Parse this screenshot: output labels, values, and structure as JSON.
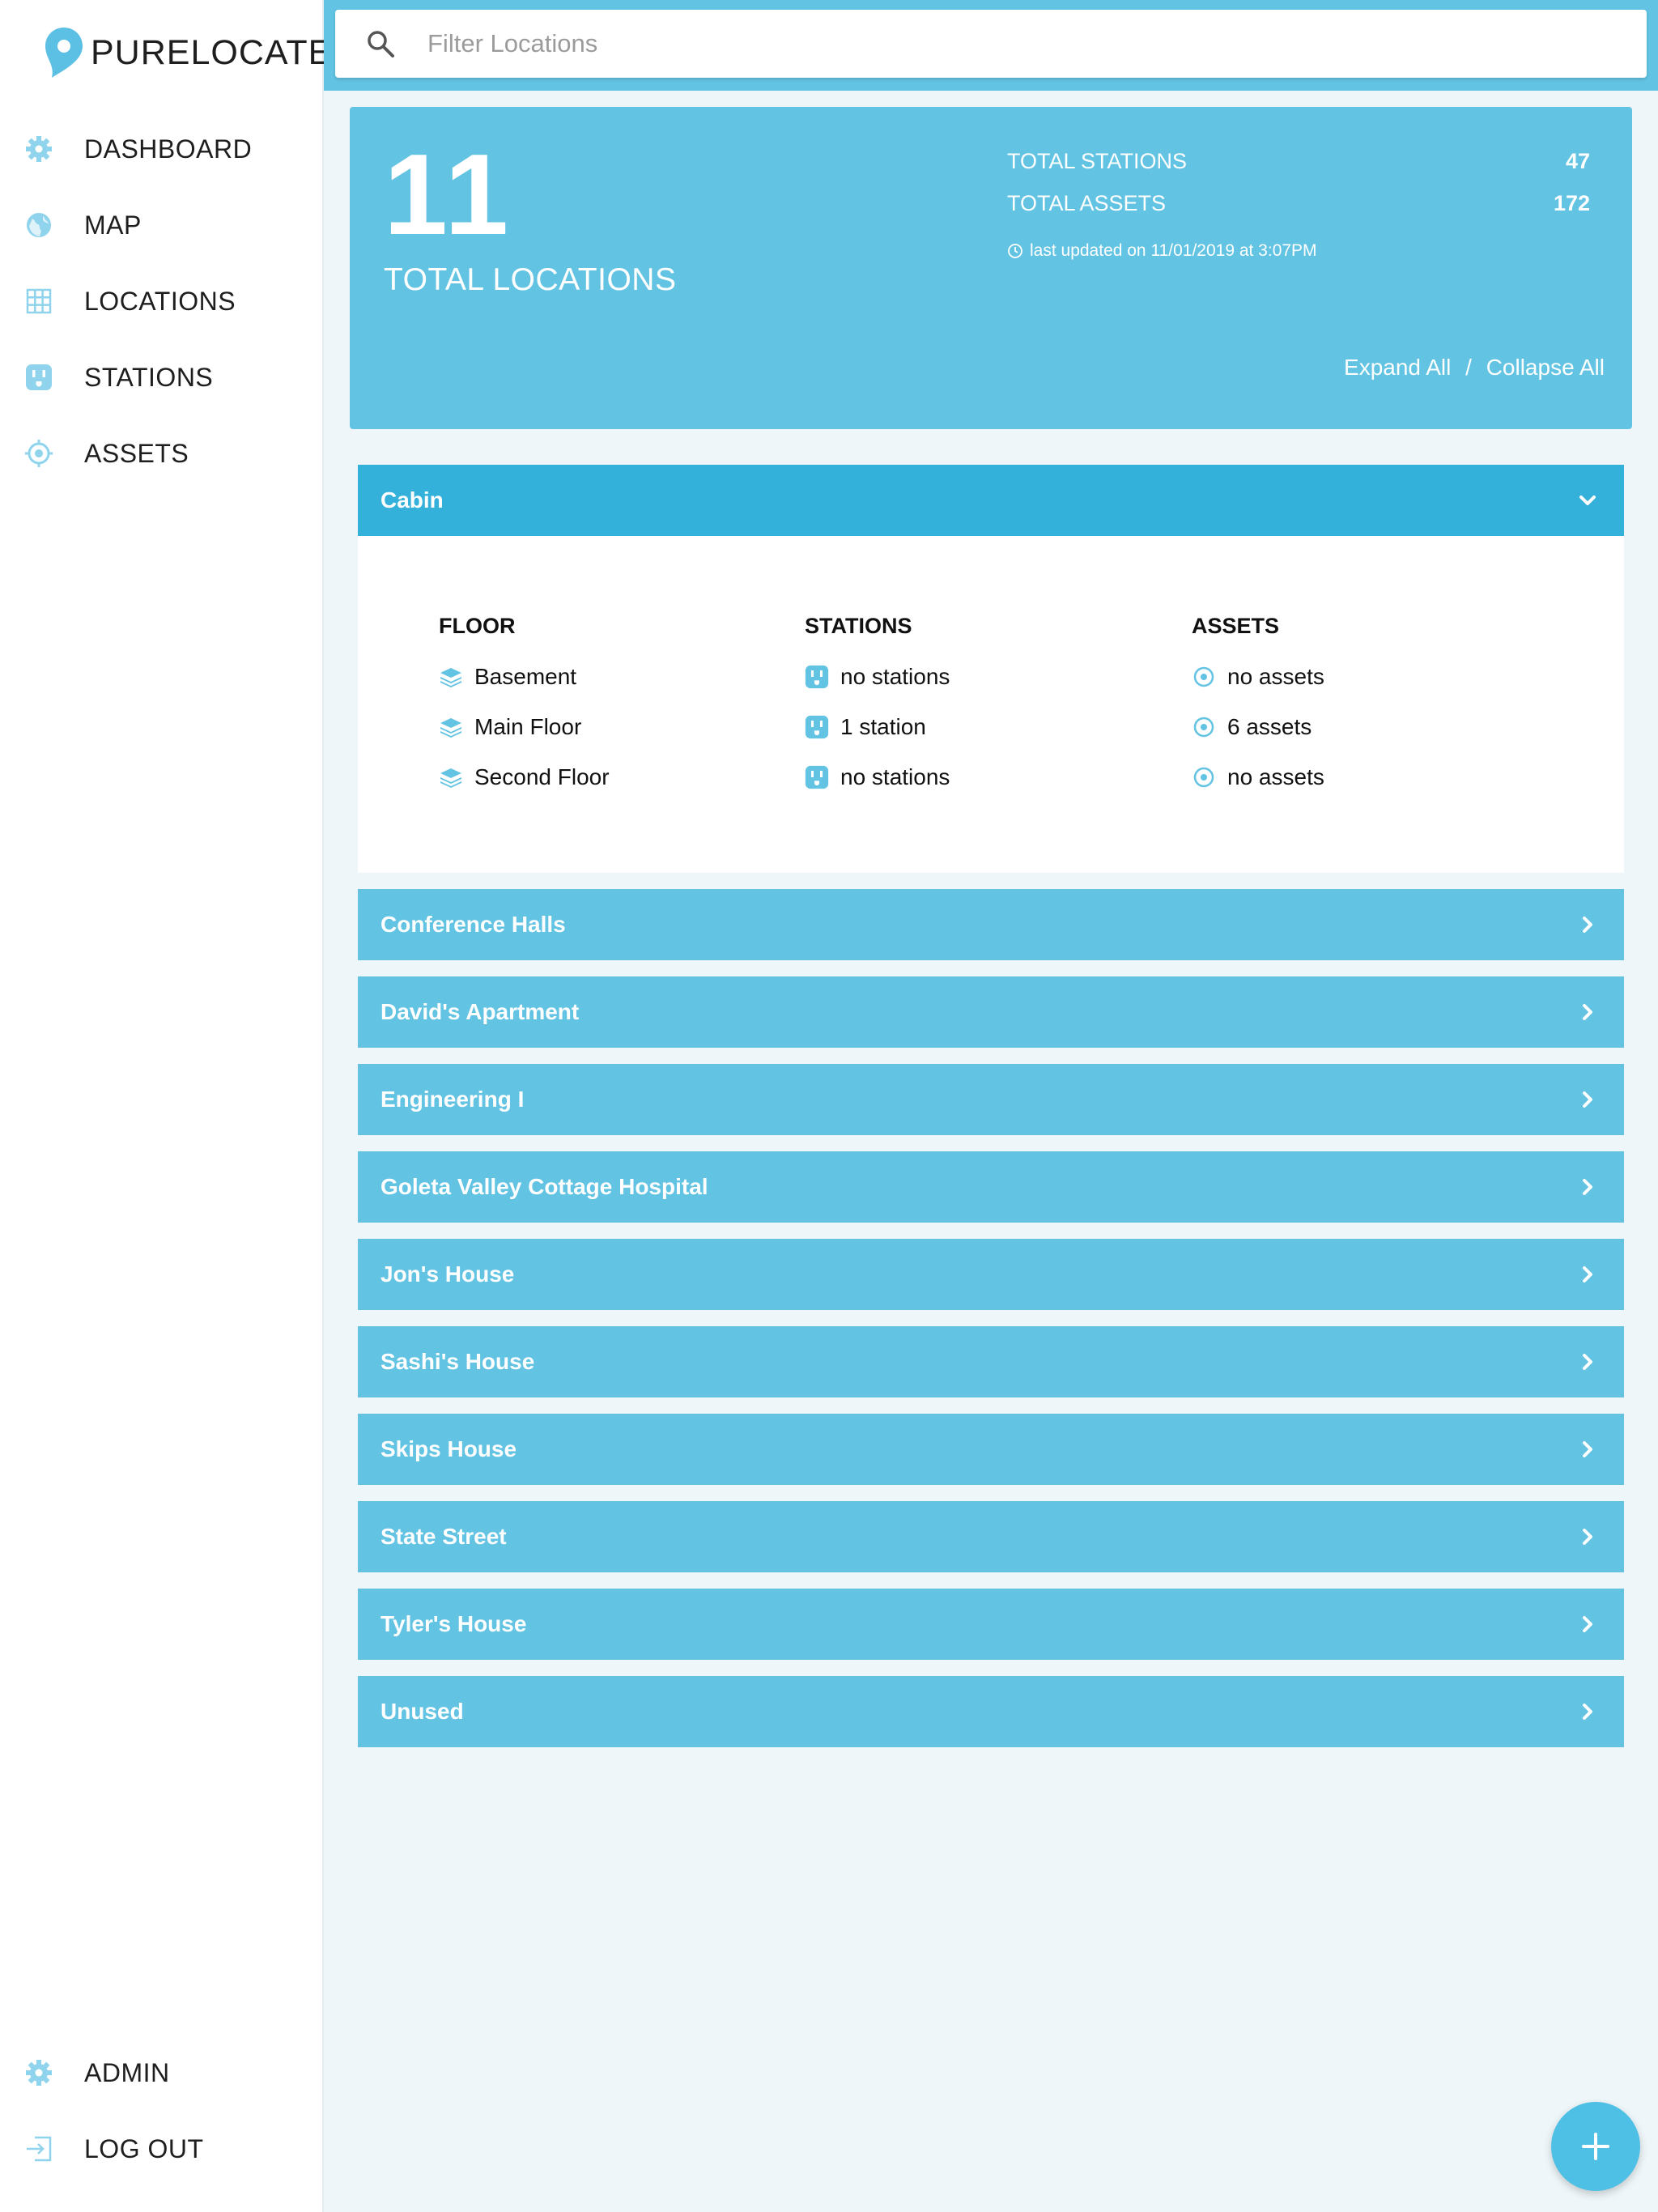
{
  "app": {
    "name": "PURELOCATE"
  },
  "nav": {
    "dashboard": "DASHBOARD",
    "map": "MAP",
    "locations": "LOCATIONS",
    "stations": "STATIONS",
    "assets": "ASSETS",
    "admin": "ADMIN",
    "logout": "LOG OUT"
  },
  "search": {
    "placeholder": "Filter Locations"
  },
  "summary": {
    "total_locations": "11",
    "total_locations_label": "TOTAL LOCATIONS",
    "total_stations_label": "TOTAL STATIONS",
    "total_stations": "47",
    "total_assets_label": "TOTAL ASSETS",
    "total_assets": "172",
    "last_updated": "last updated on 11/01/2019 at 3:07PM",
    "expand_all": "Expand All",
    "separator": "/",
    "collapse_all": "Collapse All"
  },
  "expanded_location": {
    "name": "Cabin",
    "headers": {
      "floor": "FLOOR",
      "stations": "STATIONS",
      "assets": "ASSETS"
    },
    "rows": [
      {
        "floor": "Basement",
        "stations": "no stations",
        "assets": "no assets"
      },
      {
        "floor": "Main Floor",
        "stations": "1 station",
        "assets": "6 assets"
      },
      {
        "floor": "Second Floor",
        "stations": "no stations",
        "assets": "no assets"
      }
    ]
  },
  "locations": [
    "Conference Halls",
    "David's Apartment",
    "Engineering I",
    "Goleta Valley Cottage Hospital",
    "Jon's House",
    "Sashi's House",
    "Skips House",
    "State Street",
    "Tyler's House",
    "Unused"
  ],
  "colors": {
    "accent": "#62c3e3",
    "accent_dark": "#33b1da",
    "background": "#eef6f9",
    "icon": "#62c3e3"
  },
  "icons": {
    "nav": [
      "gear-icon",
      "globe-icon",
      "grid-icon",
      "outlet-icon",
      "target-icon",
      "gear-icon",
      "logout-icon"
    ],
    "floor": "layers-icon",
    "station": "outlet-icon",
    "asset": "target-icon",
    "fab": "plus-icon"
  }
}
